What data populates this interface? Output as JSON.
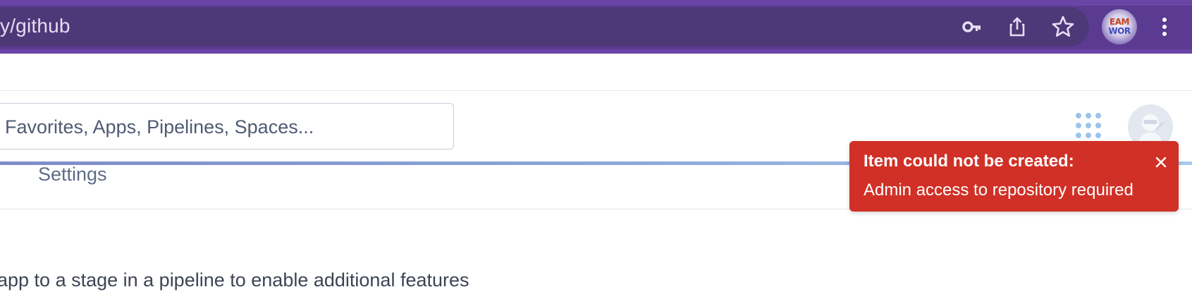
{
  "browser": {
    "url_fragment": "y/github",
    "icons": [
      "key-icon",
      "share-icon",
      "star-icon",
      "profile-avatar",
      "more-vert-icon"
    ],
    "profile_label_line1": "EAM",
    "profile_label_line2": "WOR",
    "theme_color": "#5b3a92"
  },
  "header": {
    "search_placeholder": "Favorites, Apps, Pipelines, Spaces...",
    "icons": [
      "apps-grid-icon",
      "user-avatar"
    ]
  },
  "subnav": {
    "settings_label": "Settings"
  },
  "main": {
    "pipeline_hint": "app to a stage in a pipeline to enable additional features"
  },
  "toast": {
    "title": "Item could not be created:",
    "message": "Admin access to repository required",
    "color": "#d03026",
    "icon": "close-icon"
  }
}
